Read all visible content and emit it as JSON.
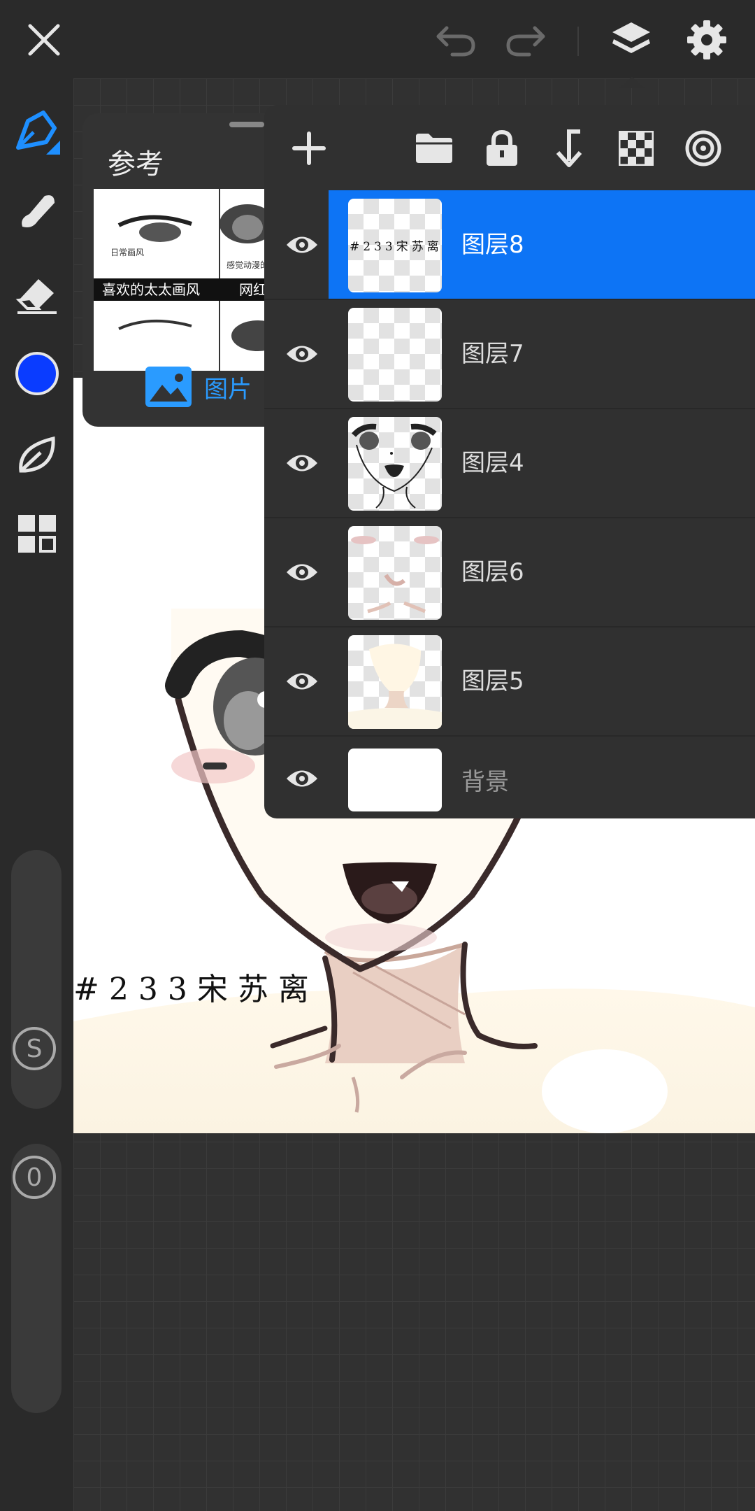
{
  "colors": {
    "accent": "#0d74f5",
    "brush_color": "#0a3cff",
    "background": "#2a2a2a"
  },
  "topbar": {
    "icons": [
      "close-icon",
      "undo-icon",
      "redo-icon",
      "layers-icon",
      "settings-icon"
    ]
  },
  "toolbar": {
    "icons": [
      "pen-icon",
      "smudge-icon",
      "eraser-icon",
      "color-picker",
      "leaf-icon",
      "grid-icon"
    ],
    "size_slider": {
      "label": "S"
    },
    "opacity_slider": {
      "label": "0"
    }
  },
  "reference": {
    "title": "参考",
    "image_captions": [
      "喜欢的太太画风",
      "网红画风",
      "日常画风",
      "感觉动漫的"
    ],
    "image_button": "图片"
  },
  "layers": {
    "toolbar_icons": [
      "add-layer-icon",
      "folder-icon",
      "lock-icon",
      "merge-down-icon",
      "transparency-icon",
      "blend-icon"
    ],
    "items": [
      {
        "name": "图层8",
        "selected": true,
        "thumb_text": "#233宋苏离"
      },
      {
        "name": "图层7",
        "selected": false
      },
      {
        "name": "图层4",
        "selected": false
      },
      {
        "name": "图层6",
        "selected": false
      },
      {
        "name": "图层5",
        "selected": false
      },
      {
        "name": "背景",
        "selected": false
      }
    ]
  },
  "canvas": {
    "watermark": "#233宋苏离"
  }
}
